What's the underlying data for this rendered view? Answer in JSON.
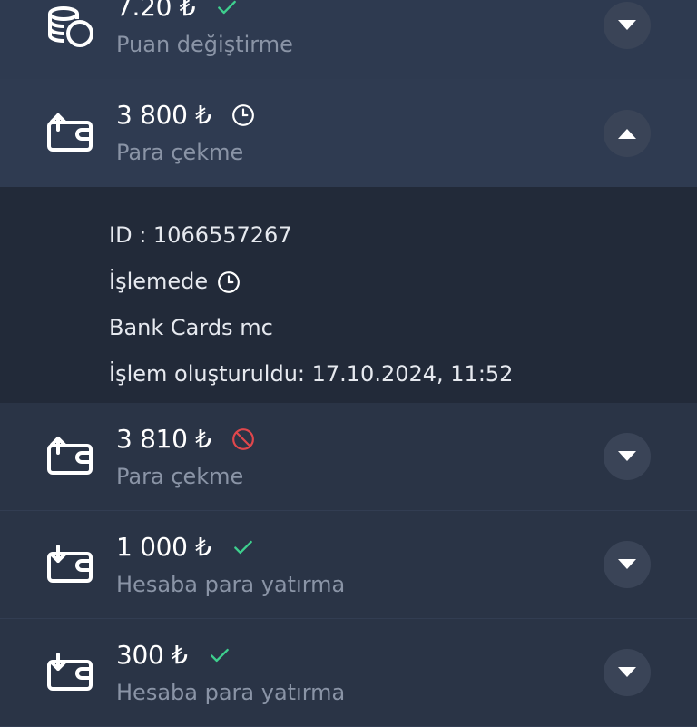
{
  "transactions": [
    {
      "amount": "7.20 ₺",
      "type": "Puan değiştirme",
      "status": "success",
      "icon": "coins-icon",
      "expanded": false
    },
    {
      "amount": "3 800 ₺",
      "type": "Para çekme",
      "status": "pending",
      "icon": "wallet-withdraw-icon",
      "expanded": true
    },
    {
      "amount": "3 810 ₺",
      "type": "Para çekme",
      "status": "cancelled",
      "icon": "wallet-withdraw-icon",
      "expanded": false
    },
    {
      "amount": "1 000 ₺",
      "type": "Hesaba para yatırma",
      "status": "success",
      "icon": "wallet-deposit-icon",
      "expanded": false
    },
    {
      "amount": "300 ₺",
      "type": "Hesaba para yatırma",
      "status": "success",
      "icon": "wallet-deposit-icon",
      "expanded": false
    }
  ],
  "details": {
    "id_line": "ID : 1066557267",
    "status_text": "İşlemede",
    "method": "Bank Cards mc",
    "created": "İşlem oluşturuldu: 17.10.2024, 11:52"
  },
  "colors": {
    "success": "#3ecf8e",
    "pending": "#ffffff",
    "cancelled": "#e0474c",
    "background": "#2a3446",
    "details_background": "#222a39"
  }
}
